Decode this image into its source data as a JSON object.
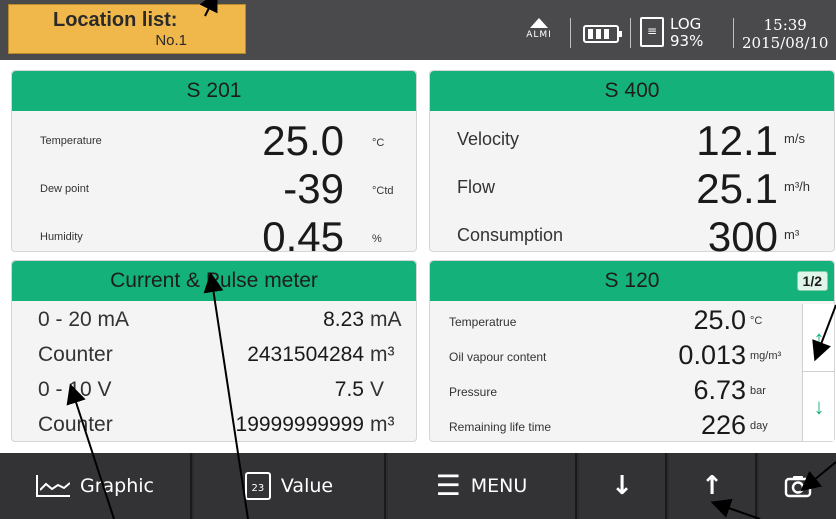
{
  "location": {
    "title": "Location list:",
    "number": "No.1"
  },
  "status": {
    "alarm_label": "ALMI",
    "log_label": "LOG",
    "log_percent": "93%",
    "time": "15:39",
    "date": "2015/08/10",
    "battery_level": 0.75
  },
  "panels": {
    "s201": {
      "title": "S 201",
      "rows": [
        {
          "label": "Temperature",
          "value": "25.0",
          "unit": "°C"
        },
        {
          "label": "Dew point",
          "value": "-39",
          "unit": "°Ctd"
        },
        {
          "label": "Humidity",
          "value": "0.45",
          "unit": "%"
        }
      ]
    },
    "s400": {
      "title": "S 400",
      "rows": [
        {
          "label": "Velocity",
          "value": "12.1",
          "unit": "m/s"
        },
        {
          "label": "Flow",
          "value": "25.1",
          "unit": "m³/h"
        },
        {
          "label": "Consumption",
          "value": "300",
          "unit": "m³"
        }
      ]
    },
    "pulse": {
      "title": "Current & Pulse meter",
      "rows": [
        {
          "label": "0 - 20 mA",
          "value": "8.23",
          "unit": "mA"
        },
        {
          "label": "Counter",
          "value": "2431504284",
          "unit": "m³"
        },
        {
          "label": "0 - 10 V",
          "value": "7.5",
          "unit": "V"
        },
        {
          "label": "Counter",
          "value": "19999999999",
          "unit": "m³"
        }
      ]
    },
    "s120": {
      "title": "S 120",
      "page": "1/2",
      "rows": [
        {
          "label": "Temperatrue",
          "value": "25.0",
          "unit": "°C"
        },
        {
          "label": "Oil vapour content",
          "value": "0.013",
          "unit": "mg/m³"
        },
        {
          "label": "Pressure",
          "value": "6.73",
          "unit": "bar"
        },
        {
          "label": "Remaining life time",
          "value": "226",
          "unit": "day"
        }
      ],
      "scroll_up_icon": "arrow-up-icon",
      "scroll_down_icon": "arrow-down-icon"
    }
  },
  "toolbar": {
    "graphic_label": "Graphic",
    "value_label": "Value",
    "value_icon_text": "23",
    "menu_label": "MENU",
    "down_icon": "↓",
    "up_icon": "↑",
    "camera_icon": "camera-icon"
  },
  "colors": {
    "header_green": "#14b27a",
    "location_tab": "#f0b84a",
    "status_bar": "#4a4a4c",
    "toolbar": "#2c2c2e"
  }
}
